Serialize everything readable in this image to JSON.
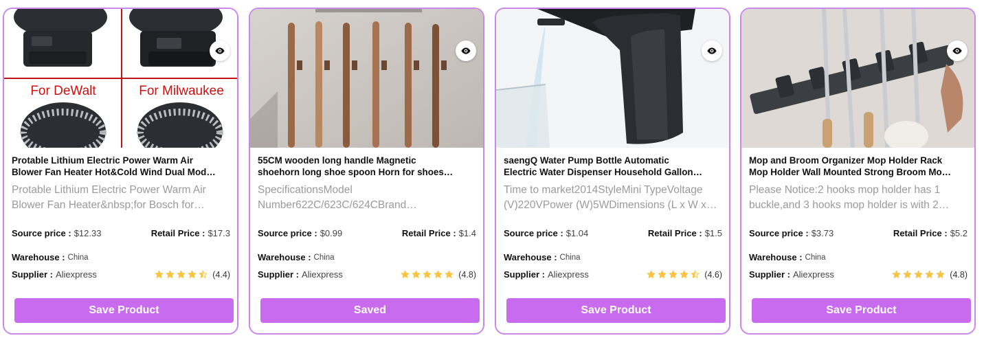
{
  "labels": {
    "source_price": "Source price :",
    "retail_price": "Retail Price :",
    "warehouse": "Warehouse :",
    "supplier": "Supplier :"
  },
  "products": [
    {
      "title_lines": [
        "Protable Lithium Electric Power Warm Air",
        "Blower Fan Heater Hot&Cold Wind Dual Mod…"
      ],
      "desc_lines": [
        "Protable Lithium Electric Power Warm Air",
        "Blower Fan Heater&nbsp;for Bosch for…"
      ],
      "image_texts": [
        "For DeWalt",
        "For Milwaukee"
      ],
      "source_price": "$12.33",
      "retail_price": "$17.3",
      "warehouse": "China",
      "supplier": "Aliexpress",
      "rating": "(4.4)",
      "rating_value": 4.4,
      "button": "Save Product"
    },
    {
      "title_lines": [
        "55CM wooden long handle Magnetic",
        "shoehorn long shoe spoon Horn for shoes…"
      ],
      "desc_lines": [
        "SpecificationsModel",
        "Number622C/623C/624CBrand…"
      ],
      "source_price": "$0.99",
      "retail_price": "$1.4",
      "warehouse": "China",
      "supplier": "Aliexpress",
      "rating": "(4.8)",
      "rating_value": 4.8,
      "button": "Saved"
    },
    {
      "title_lines": [
        "saengQ Water Pump Bottle Automatic",
        "Electric Water Dispenser Household Gallon…"
      ],
      "desc_lines": [
        "Time to market2014StyleMini TypeVoltage",
        "(V)220VPower (W)5WDimensions (L x W x…"
      ],
      "source_price": "$1.04",
      "retail_price": "$1.5",
      "warehouse": "China",
      "supplier": "Aliexpress",
      "rating": "(4.6)",
      "rating_value": 4.6,
      "button": "Save Product"
    },
    {
      "title_lines": [
        "Mop and Broom Organizer Mop Holder Rack",
        "Mop Holder Wall Mounted Strong Broom Mo…"
      ],
      "desc_lines": [
        "Please Notice:2 hooks mop holder has 1",
        "buckle,and 3 hooks mop holder is with 2…"
      ],
      "source_price": "$3.73",
      "retail_price": "$5.2",
      "warehouse": "China",
      "supplier": "Aliexpress",
      "rating": "(4.8)",
      "rating_value": 4.8,
      "button": "Save Product"
    }
  ],
  "colors": {
    "card_border": "#c889e8",
    "button_bg": "#c96bee",
    "star": "#f6c343",
    "image_text_red": "#cc1111"
  }
}
